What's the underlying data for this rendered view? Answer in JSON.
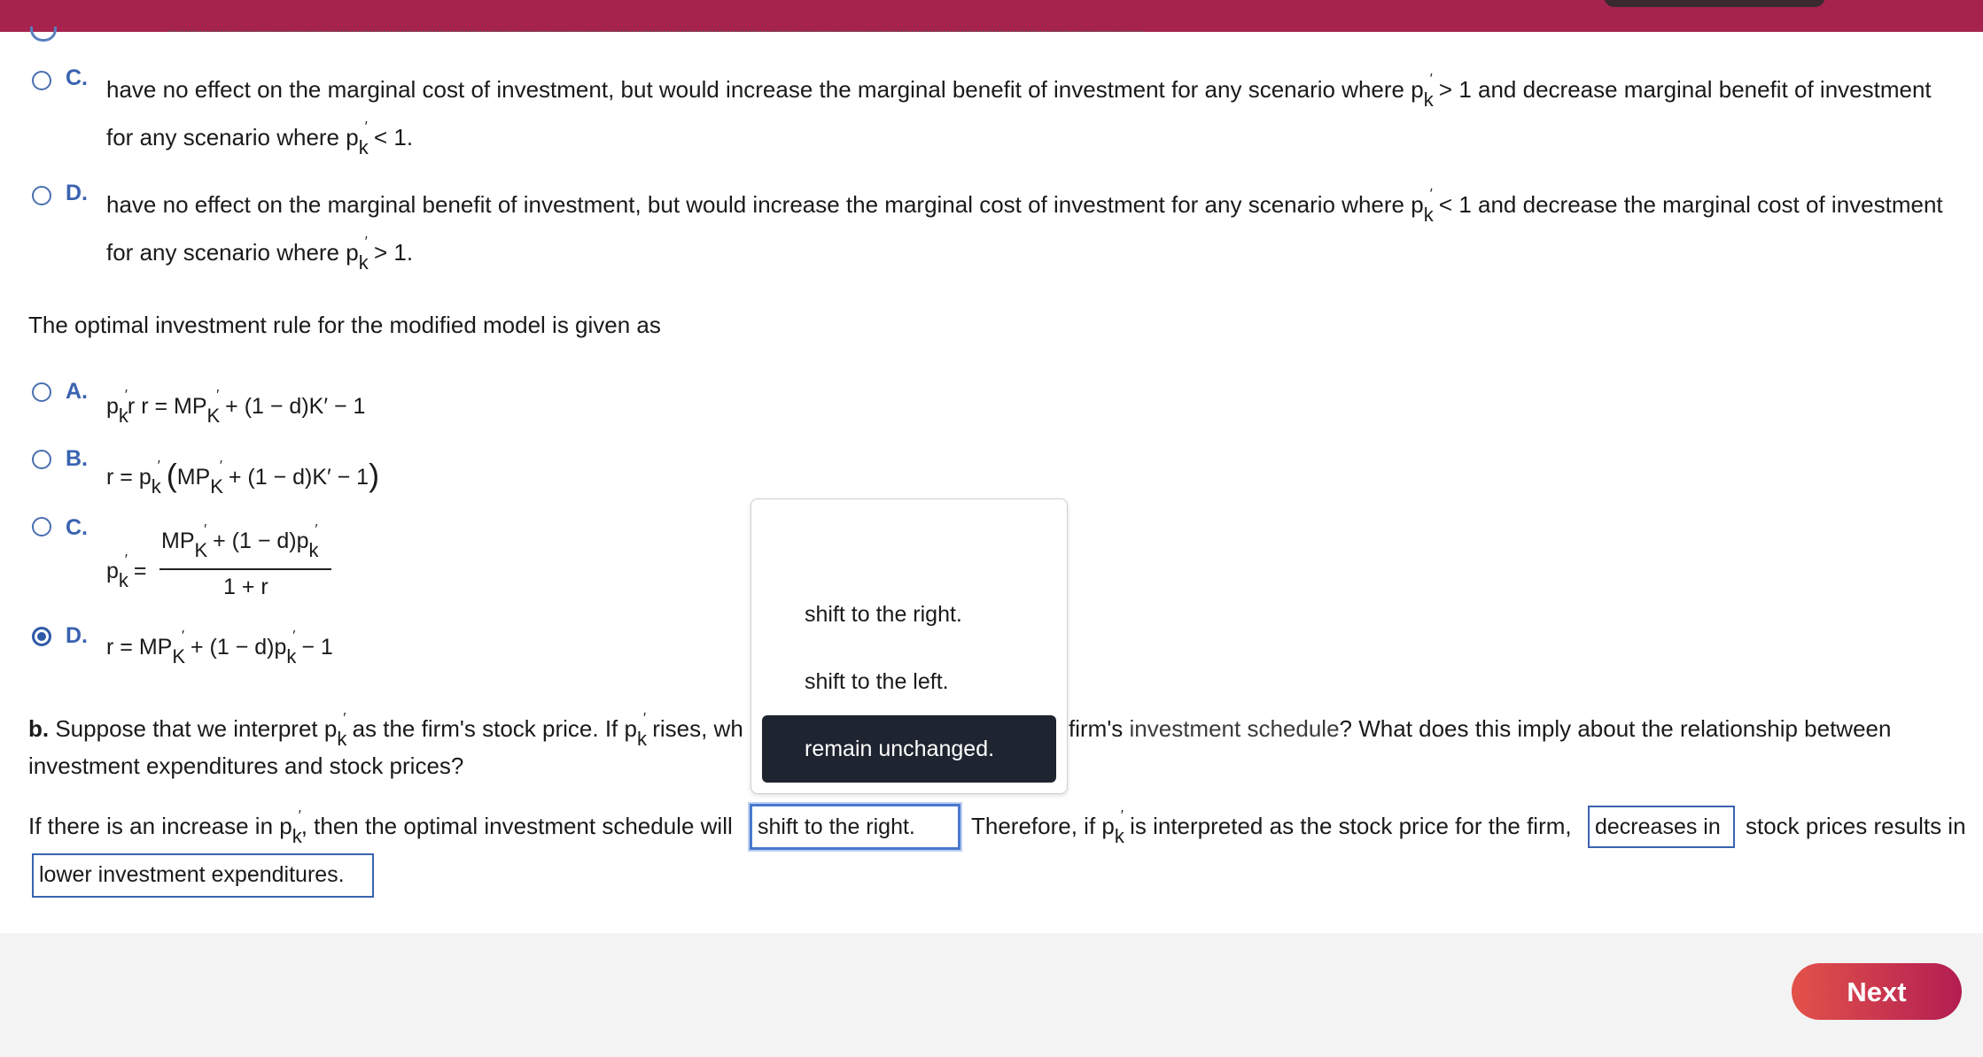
{
  "header": {
    "brand_color": "#a6234e"
  },
  "part_a_prev": {
    "options": [
      {
        "letter": "C.",
        "line1": "have no effect on the marginal cost of investment, but would increase the marginal benefit of investment for any scenario where p",
        "line1_end": "> 1 and decrease marginal benefit of investment",
        "line2": "for any scenario where p",
        "line2_end": "< 1."
      },
      {
        "letter": "D.",
        "line1": "have no effect on the marginal benefit of investment, but would increase the marginal cost of investment for any scenario where p",
        "line1_end": "< 1 and decrease the marginal cost of investment",
        "line2": "for any scenario where p",
        "line2_end": "> 1."
      }
    ]
  },
  "rule": {
    "prompt": "The optimal investment rule for the modified model is given as",
    "A": {
      "letter": "A.",
      "eq": "r = MP",
      "eq2": "+ (1 − d)K′ − 1"
    },
    "B": {
      "letter": "B.",
      "eq": "r = p",
      "eq2": "MP",
      "eq3": "+ (1 − d)K′ − 1"
    },
    "C": {
      "letter": "C.",
      "num": "MP",
      "num2": "+ (1 − d)p",
      "den": "1 + r",
      "lhs": "p",
      "eq": "="
    },
    "D": {
      "letter": "D.",
      "eq": "r = MP",
      "eq2": "+ (1 − d)p",
      "eq3": "− 1",
      "selected": true
    }
  },
  "symbols": {
    "p": "p",
    "k": "k",
    "K": "K",
    "prime": "′",
    "r": "r"
  },
  "part_b": {
    "bold": "b.",
    "q1": "Suppose that we interpret p",
    "q2": "as the firm's stock price. If p",
    "q3": "rises, wh",
    "q4": "firm's",
    "q5": "investment schedule",
    "q6": "? What does this imply about the relationship between",
    "q7": "investment expenditures and stock prices?"
  },
  "answer": {
    "s1": "If there is an increase in p",
    "s2": ", then the optimal investment schedule will",
    "blank1": "shift to the right.",
    "s3": "Therefore, if p",
    "s4": "is interpreted as the stock price for the firm,",
    "blank2": "decreases in",
    "s5": "stock prices results in",
    "blank3": "lower investment expenditures."
  },
  "dropdown": {
    "options": [
      "shift to the right.",
      "shift to the left.",
      "remain unchanged."
    ],
    "highlighted": "remain unchanged."
  },
  "footer": {
    "next_label": "Next"
  }
}
